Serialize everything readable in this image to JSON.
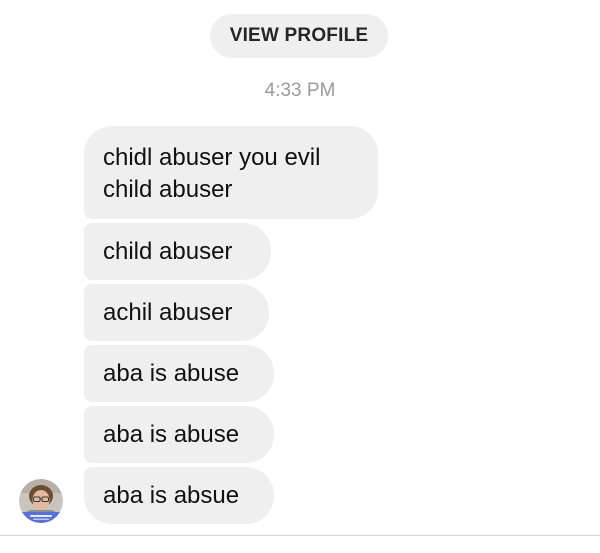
{
  "header": {
    "view_profile_label": "VIEW PROFILE"
  },
  "thread": {
    "timestamp": "4:33 PM",
    "messages": [
      {
        "text": "chidl abuser you evil\nchild abuser"
      },
      {
        "text": "child abuser"
      },
      {
        "text": "achil abuser"
      },
      {
        "text": "aba is abuse"
      },
      {
        "text": "aba is abuse"
      },
      {
        "text": "aba is absue"
      }
    ]
  },
  "colors": {
    "bubble_bg": "#efefef",
    "button_bg": "#efefef",
    "timestamp_text": "#9b9b9b",
    "message_text": "#111111",
    "avatar_ring": "#5b6fd8"
  },
  "icons": {
    "sender_avatar": "user-avatar-icon"
  }
}
